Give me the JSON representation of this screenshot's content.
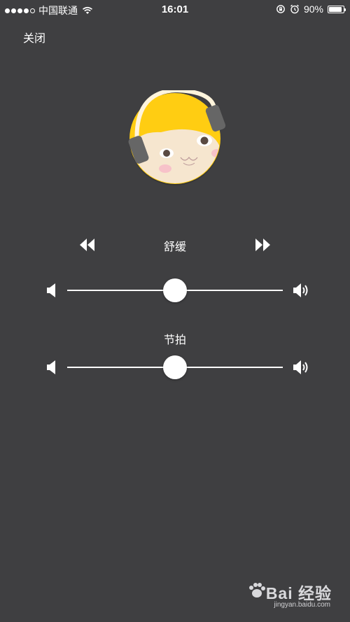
{
  "status_bar": {
    "carrier": "中国联通",
    "time": "16:01",
    "battery_percent": "90%",
    "battery_level": 0.9
  },
  "close_label": "关闭",
  "player": {
    "track_title": "舒缓",
    "beat_label": "节拍",
    "melody_volume": 0.5,
    "beat_volume": 0.5
  },
  "watermark": {
    "logo": "Bai 经验",
    "url": "jingyan.baidu.com"
  },
  "icons": [
    "signal-dots-icon",
    "wifi-icon",
    "rotation-lock-icon",
    "alarm-icon",
    "battery-icon",
    "rewind-icon",
    "fast-forward-icon",
    "volume-low-icon",
    "volume-high-icon",
    "paw-icon"
  ],
  "colors": {
    "background": "#3f3f41",
    "accent_yellow": "#ffcd12",
    "foreground": "#ffffff"
  }
}
